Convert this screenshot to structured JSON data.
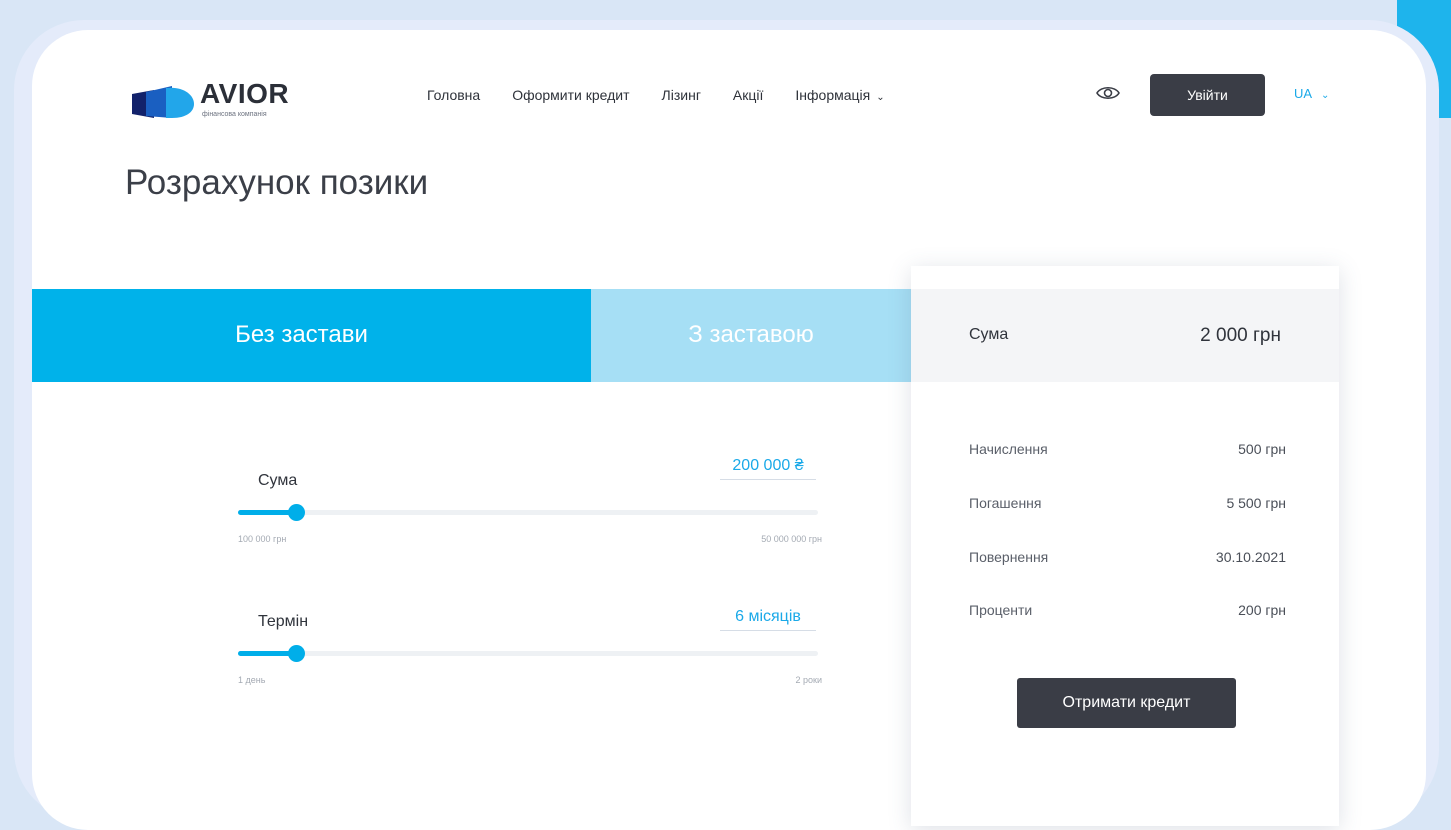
{
  "header": {
    "logo_text": "AVIOR",
    "logo_subtitle": "фінансова компанія",
    "nav": [
      "Головна",
      "Оформити кредит",
      "Лізинг",
      "Акції",
      "Інформація"
    ],
    "login_label": "Увійти",
    "language": "UA",
    "accessibility_icon": "eye-icon"
  },
  "page": {
    "title": "Розрахунок позики"
  },
  "tabs": {
    "active": "Без застави",
    "inactive": "З заставою"
  },
  "amount_slider": {
    "label": "Сума",
    "value": "200 000 ₴",
    "min_label": "100 000 грн",
    "max_label": "50 000 000 грн",
    "position_fraction": 0.1
  },
  "term_slider": {
    "label": "Термін",
    "value": "6 місяців",
    "min_label": "1 день",
    "max_label": "2 роки",
    "position_fraction": 0.1
  },
  "summary": {
    "sum_label": "Сума",
    "sum_value": "2 000 грн",
    "rows": [
      {
        "label": "Начислення",
        "value": "500 грн"
      },
      {
        "label": "Погашення",
        "value": "5 500 грн"
      },
      {
        "label": "Повернення",
        "value": "30.10.2021"
      },
      {
        "label": "Проценти",
        "value": "200 грн"
      }
    ],
    "cta_label": "Отримати кредит"
  },
  "colors": {
    "accent": "#00b2ea",
    "accent_light": "#a6dff5",
    "dark_button": "#3a3d46"
  }
}
